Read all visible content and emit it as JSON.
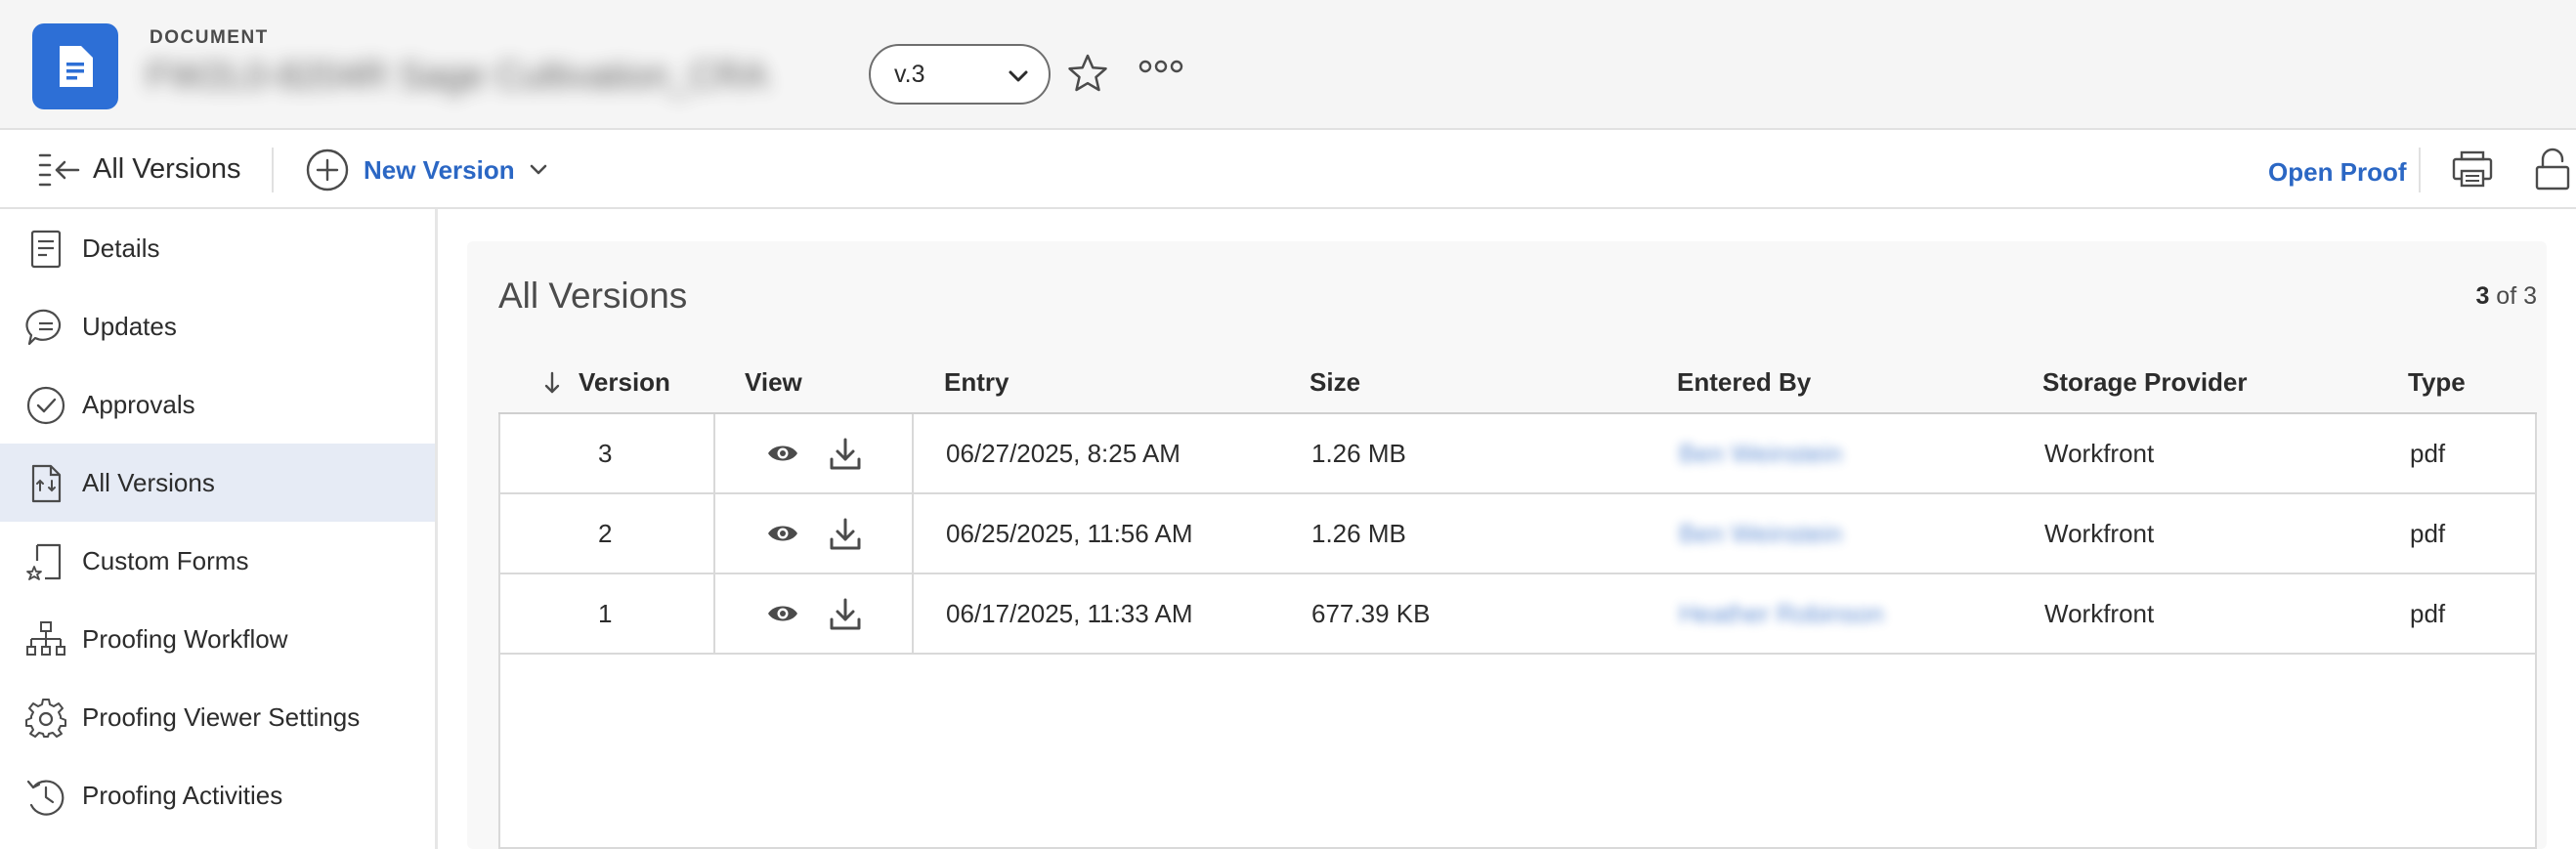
{
  "header": {
    "doc_type": "DOCUMENT",
    "doc_name": "FW2L0-8204R Sage Cultivation_CRA",
    "version_selected": "v.3"
  },
  "toolbar": {
    "title": "All Versions",
    "new_version_label": "New Version",
    "open_proof_label": "Open Proof"
  },
  "sidebar": {
    "items": [
      {
        "label": "Details",
        "icon": "details-icon"
      },
      {
        "label": "Updates",
        "icon": "updates-icon"
      },
      {
        "label": "Approvals",
        "icon": "approvals-icon"
      },
      {
        "label": "All Versions",
        "icon": "all-versions-icon",
        "active": true
      },
      {
        "label": "Custom Forms",
        "icon": "custom-forms-icon"
      },
      {
        "label": "Proofing Workflow",
        "icon": "proofing-workflow-icon"
      },
      {
        "label": "Proofing Viewer Settings",
        "icon": "gear-icon"
      },
      {
        "label": "Proofing Activities",
        "icon": "proofing-activities-icon"
      }
    ]
  },
  "main": {
    "title": "All Versions",
    "count_current": "3",
    "count_total": "of 3",
    "columns": [
      "Version",
      "View",
      "Entry",
      "Size",
      "Entered By",
      "Storage Provider",
      "Type"
    ],
    "rows": [
      {
        "version": "3",
        "entry": "06/27/2025, 8:25 AM",
        "size": "1.26 MB",
        "entered_by": "Ben Weinstein",
        "storage": "Workfront",
        "type": "pdf"
      },
      {
        "version": "2",
        "entry": "06/25/2025, 11:56 AM",
        "size": "1.26 MB",
        "entered_by": "Ben Weinstein",
        "storage": "Workfront",
        "type": "pdf"
      },
      {
        "version": "1",
        "entry": "06/17/2025, 11:33 AM",
        "size": "677.39 KB",
        "entered_by": "Heather Robinson",
        "storage": "Workfront",
        "type": "pdf"
      }
    ]
  },
  "colors": {
    "brand_blue": "#2d6fd6",
    "link_blue": "#2b67c4",
    "active_bg": "#e6ebf5"
  }
}
